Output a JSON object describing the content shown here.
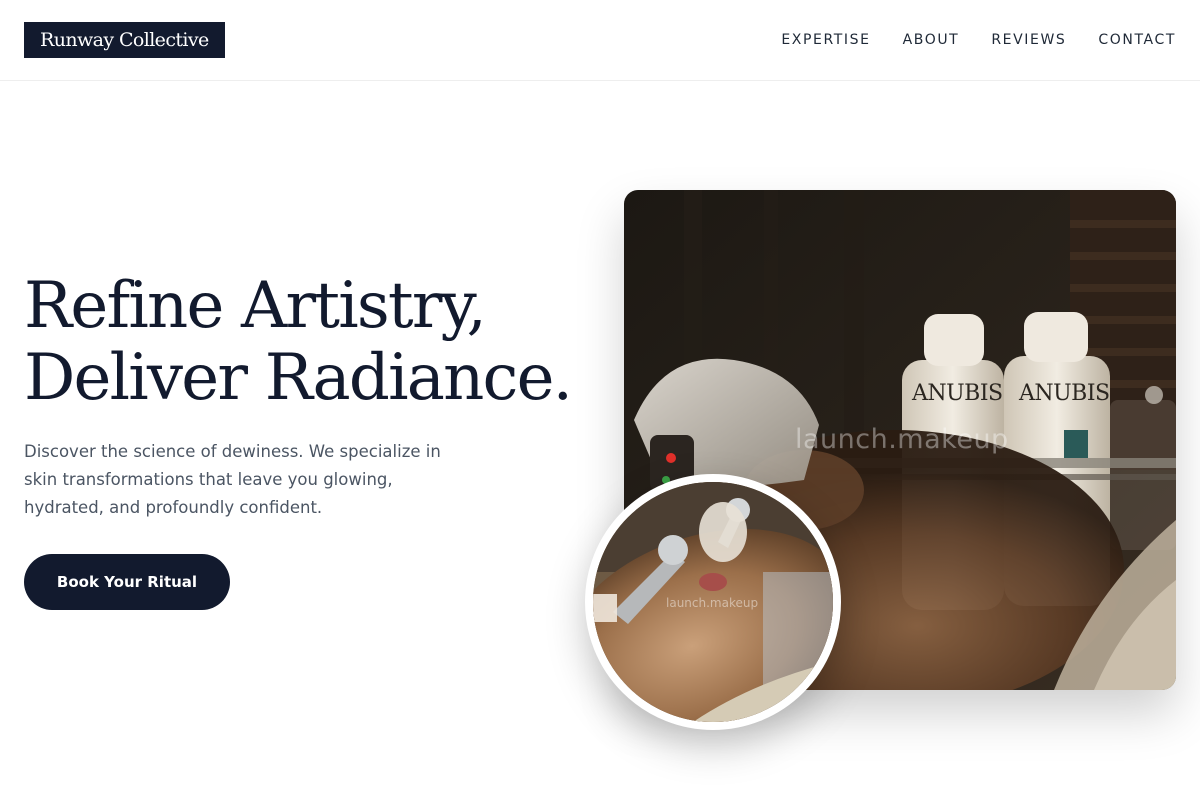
{
  "brand": {
    "name": "Runway Collective"
  },
  "nav": {
    "items": [
      {
        "label": "EXPERTISE"
      },
      {
        "label": "ABOUT"
      },
      {
        "label": "REVIEWS"
      },
      {
        "label": "CONTACT"
      }
    ]
  },
  "hero": {
    "title_line1": "Refine Artistry,",
    "title_line2": "Deliver Radiance.",
    "description": "Discover the science of dewiness. We specialize in skin transformations that leave you glowing, hydrated, and profoundly confident.",
    "cta_label": "Book Your Ritual"
  },
  "images": {
    "main_watermark": "launch.makeup",
    "inset_watermark": "launch.makeup",
    "bottle_brand_1": "ANUBIS",
    "bottle_brand_2": "ANUBIS"
  },
  "colors": {
    "primary": "#121a2e",
    "text_muted": "#4b5563",
    "background": "#ffffff"
  }
}
